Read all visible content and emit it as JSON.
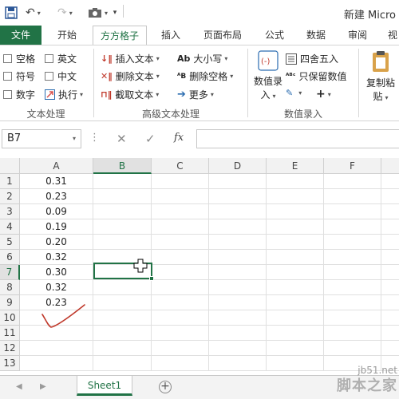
{
  "title_bar": {
    "quick_access": [
      "save-icon",
      "undo-icon",
      "redo-icon",
      "screenshot-icon",
      "customize-icon"
    ],
    "title": "新建 Micro"
  },
  "tabs": [
    "文件",
    "开始",
    "方方格子",
    "插入",
    "页面布局",
    "公式",
    "数据",
    "审阅",
    "视"
  ],
  "active_tab": "方方格子",
  "ribbon": {
    "text_processing": {
      "checkboxes": [
        "空格",
        "英文",
        "符号",
        "中文",
        "数字"
      ],
      "execute_label": "执行",
      "group_label": "文本处理"
    },
    "advanced_text": {
      "buttons": [
        "插入文本",
        "删除文本",
        "截取文本",
        "大小写",
        "删除空格",
        "更多"
      ],
      "group_label": "高级文本处理"
    },
    "number_entry": {
      "big_button_line1": "数值录",
      "big_button_line2": "入",
      "buttons": [
        "四舍五入",
        "只保留数值"
      ],
      "group_label": "数值录入"
    },
    "paste": {
      "line1": "复制粘",
      "line2": "贴"
    }
  },
  "formula_bar": {
    "name_box": "B7",
    "fx_label": "fx",
    "formula": ""
  },
  "grid": {
    "columns": [
      "A",
      "B",
      "C",
      "D",
      "E",
      "F"
    ],
    "selected_column": "B",
    "rows": [
      "1",
      "2",
      "3",
      "4",
      "5",
      "6",
      "7",
      "8",
      "9",
      "10",
      "11",
      "12",
      "13"
    ],
    "selected_row": "7",
    "column_a_values": [
      "0.31",
      "0.23",
      "0.09",
      "0.19",
      "0.20",
      "0.32",
      "0.30",
      "0.32",
      "0.23"
    ]
  },
  "sheet_tabs": {
    "tabs": [
      "Sheet1"
    ],
    "add_label": "+"
  },
  "watermark": {
    "url": "jb51.net",
    "name": "脚本之家"
  },
  "colors": {
    "accent": "#217346",
    "annotation": "#c0392b"
  }
}
